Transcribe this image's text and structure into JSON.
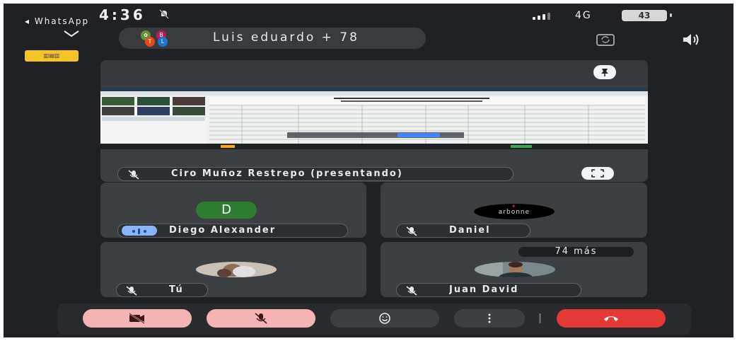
{
  "status_bar": {
    "time": "4:36",
    "back_app": "◂ WhatsApp",
    "network": "4G",
    "battery": "43"
  },
  "header": {
    "title": "Luis eduardo + 78",
    "header_avatars": [
      "B",
      "T",
      "L"
    ]
  },
  "presentation": {
    "presenter_label": "Ciro Muñoz Restrepo (presentando)"
  },
  "participants": [
    {
      "name": "Diego Alexander",
      "initial": "D",
      "mic": "speaking"
    },
    {
      "name": "Daniel",
      "logo_text": "arbonne",
      "mic": "muted"
    },
    {
      "name": "Tú",
      "mic": "muted"
    },
    {
      "name": "Juan David",
      "mic": "muted"
    }
  ],
  "overflow": {
    "label": "74 más"
  },
  "controls": {
    "camera": "video-off-icon",
    "mic": "mic-off-icon",
    "reactions": "emoji-icon",
    "more": "more-vert-icon",
    "end": "call-end-icon"
  },
  "colors": {
    "background": "#202124",
    "tile": "#3c4043",
    "muted_button": "#f4b4b4",
    "end_call": "#e53935",
    "avatar_green": "#2e7d32",
    "badge_yellow": "#f6c228"
  }
}
